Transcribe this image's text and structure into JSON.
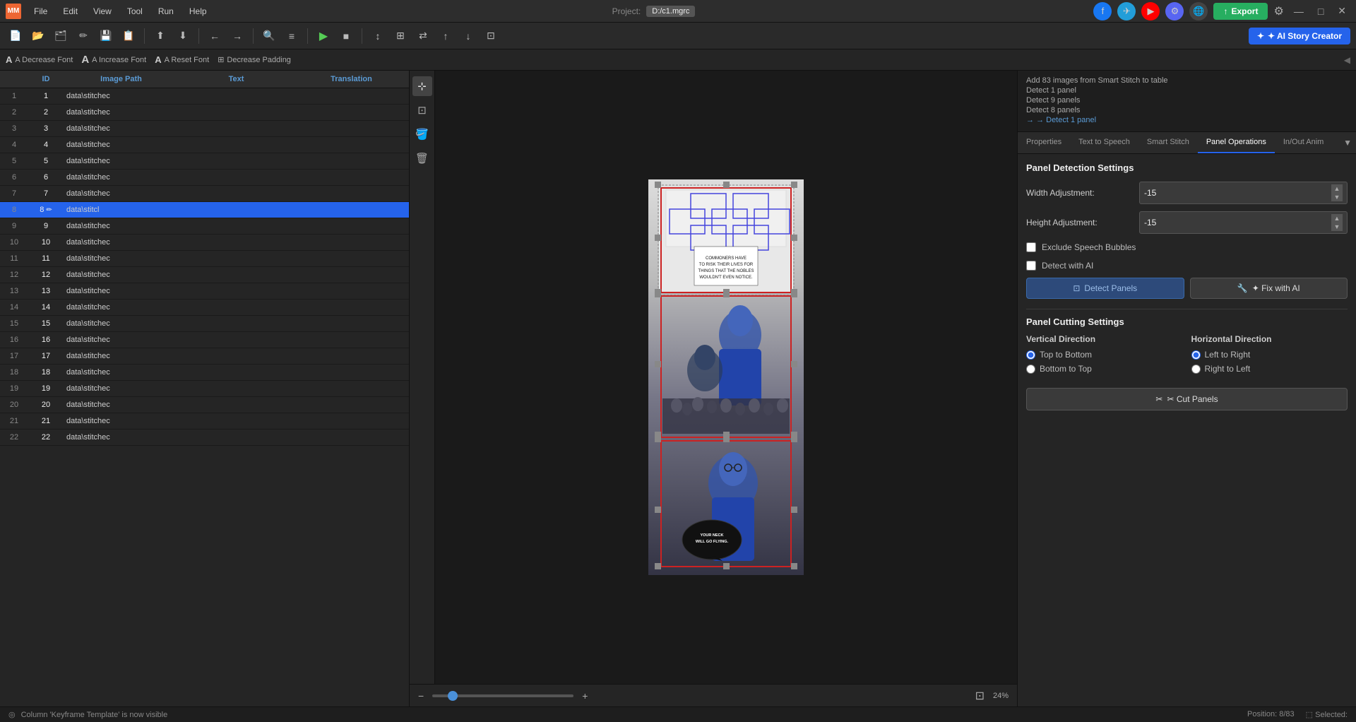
{
  "app": {
    "logo": "MM",
    "menu_items": [
      "File",
      "Edit",
      "View",
      "Tool",
      "Run",
      "Help"
    ],
    "project_label": "Project:",
    "project_path": "D:/c1.mgrc"
  },
  "toolbar": {
    "tools": [
      "new",
      "open",
      "folder",
      "edit",
      "save",
      "saveas",
      "import",
      "export-file",
      "undo",
      "redo",
      "zoom",
      "list"
    ],
    "play": "▶",
    "stop": "■"
  },
  "sub_toolbar": {
    "decrease_font": "A Decrease Font",
    "increase_font": "A Increase Font",
    "reset_font": "A Reset Font",
    "decrease_padding": "⊞ Decrease Padding"
  },
  "table": {
    "columns": [
      "",
      "ID",
      "Image Path",
      "Text",
      "Translation"
    ],
    "rows": [
      {
        "num": 1,
        "id": "1",
        "path": "data\\stitchec",
        "text": "",
        "translation": ""
      },
      {
        "num": 2,
        "id": "2",
        "path": "data\\stitchec",
        "text": "",
        "translation": ""
      },
      {
        "num": 3,
        "id": "3",
        "path": "data\\stitchec",
        "text": "",
        "translation": ""
      },
      {
        "num": 4,
        "id": "4",
        "path": "data\\stitchec",
        "text": "",
        "translation": ""
      },
      {
        "num": 5,
        "id": "5",
        "path": "data\\stitchec",
        "text": "",
        "translation": ""
      },
      {
        "num": 6,
        "id": "6",
        "path": "data\\stitchec",
        "text": "",
        "translation": ""
      },
      {
        "num": 7,
        "id": "7",
        "path": "data\\stitchec",
        "text": "",
        "translation": ""
      },
      {
        "num": 8,
        "id": "8",
        "path": "data\\stitcl",
        "text": "",
        "translation": "",
        "selected": true
      },
      {
        "num": 9,
        "id": "9",
        "path": "data\\stitchec",
        "text": "",
        "translation": ""
      },
      {
        "num": 10,
        "id": "10",
        "path": "data\\stitchec",
        "text": "",
        "translation": ""
      },
      {
        "num": 11,
        "id": "11",
        "path": "data\\stitchec",
        "text": "",
        "translation": ""
      },
      {
        "num": 12,
        "id": "12",
        "path": "data\\stitchec",
        "text": "",
        "translation": ""
      },
      {
        "num": 13,
        "id": "13",
        "path": "data\\stitchec",
        "text": "",
        "translation": ""
      },
      {
        "num": 14,
        "id": "14",
        "path": "data\\stitchec",
        "text": "",
        "translation": ""
      },
      {
        "num": 15,
        "id": "15",
        "path": "data\\stitchec",
        "text": "",
        "translation": ""
      },
      {
        "num": 16,
        "id": "16",
        "path": "data\\stitchec",
        "text": "",
        "translation": ""
      },
      {
        "num": 17,
        "id": "17",
        "path": "data\\stitchec",
        "text": "",
        "translation": ""
      },
      {
        "num": 18,
        "id": "18",
        "path": "data\\stitchec",
        "text": "",
        "translation": ""
      },
      {
        "num": 19,
        "id": "19",
        "path": "data\\stitchec",
        "text": "",
        "translation": ""
      },
      {
        "num": 20,
        "id": "20",
        "path": "data\\stitchec",
        "text": "",
        "translation": ""
      },
      {
        "num": 21,
        "id": "21",
        "path": "data\\stitchec",
        "text": "",
        "translation": ""
      },
      {
        "num": 22,
        "id": "22",
        "path": "data\\stitchec",
        "text": "",
        "translation": ""
      }
    ]
  },
  "log": {
    "lines": [
      "Add 83 images from Smart Stitch to table",
      "Detect 1 panel",
      "Detect 9 panels",
      "Detect 8 panels",
      "→ Detect 1 panel"
    ]
  },
  "right_tabs": {
    "tabs": [
      "Properties",
      "Text to Speech",
      "Smart Stitch",
      "Panel Operations",
      "In/Out Anim"
    ],
    "active": "Panel Operations"
  },
  "panel_detection": {
    "section_title": "Panel Detection Settings",
    "width_label": "Width Adjustment:",
    "width_value": "-15",
    "height_label": "Height Adjustment:",
    "height_value": "-15",
    "exclude_speech": "Exclude Speech Bubbles",
    "detect_ai": "Detect with AI",
    "detect_btn": "Detect Panels",
    "fix_ai_btn": "✦ Fix with AI"
  },
  "panel_cutting": {
    "section_title": "Panel Cutting Settings",
    "vertical_title": "Vertical Direction",
    "horizontal_title": "Horizontal Direction",
    "vertical_options": [
      "Top to Bottom",
      "Bottom to Top"
    ],
    "horizontal_options": [
      "Left to Right",
      "Right to Left"
    ],
    "vertical_selected": "Top to Bottom",
    "horizontal_selected": "Left to Right",
    "cut_btn": "✂ Cut Panels"
  },
  "zoom": {
    "value": 24,
    "unit": "%",
    "zoom_in": "+",
    "zoom_out": "−"
  },
  "status_bar": {
    "message": "Column 'Keyframe Template' is now visible",
    "position_label": "Position:",
    "position_value": "8/83",
    "selected_label": "Selected:",
    "position_icon": "◎",
    "selected_icon": "⬚"
  },
  "export_btn": "Export",
  "ai_story_btn": "✦ AI Story Creator"
}
